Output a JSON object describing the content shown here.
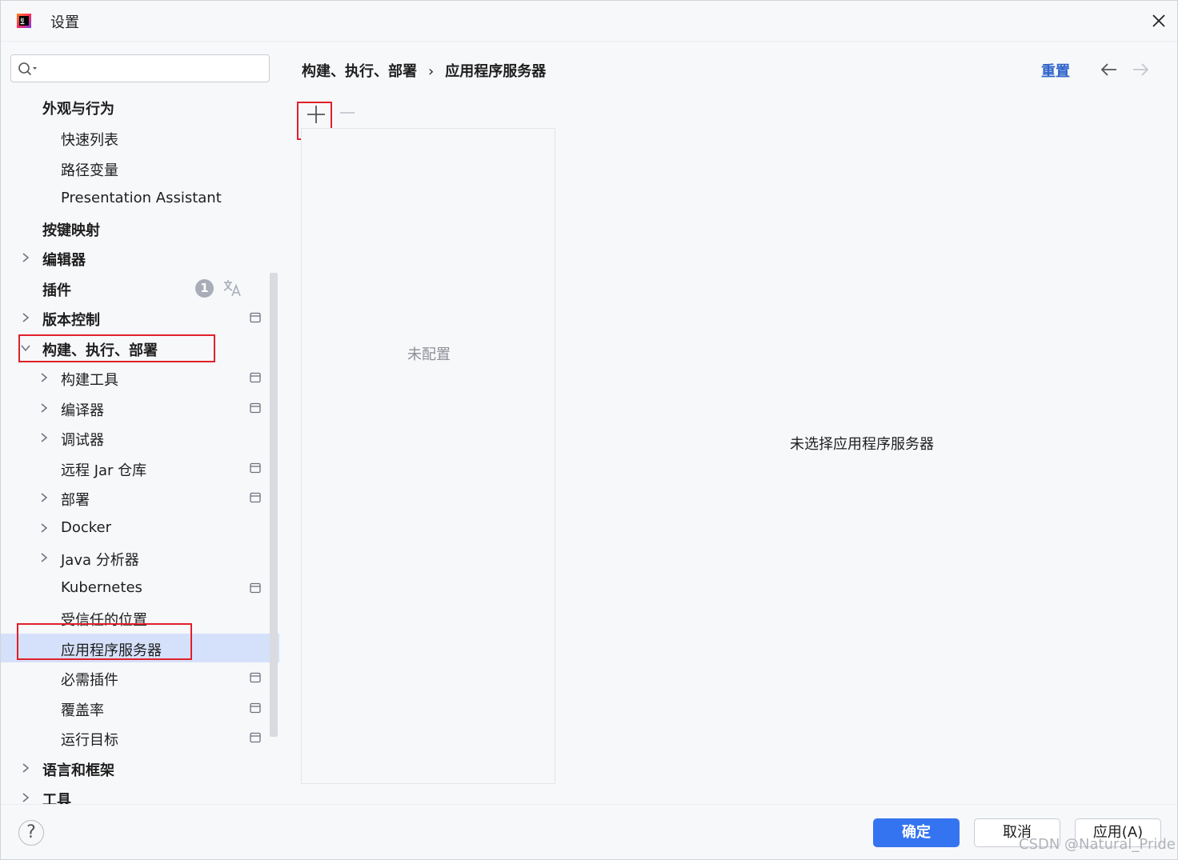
{
  "window": {
    "title": "设置"
  },
  "search": {
    "placeholder": "",
    "value": ""
  },
  "sidebar": {
    "items": [
      {
        "label": "外观与行为",
        "level": 0,
        "bold": true,
        "chevron": "",
        "icon": ""
      },
      {
        "label": "快速列表",
        "level": 1,
        "bold": false,
        "chevron": "",
        "icon": ""
      },
      {
        "label": "路径变量",
        "level": 1,
        "bold": false,
        "chevron": "",
        "icon": ""
      },
      {
        "label": "Presentation Assistant",
        "level": 1,
        "bold": false,
        "chevron": "",
        "icon": ""
      },
      {
        "label": "按键映射",
        "level": 0,
        "bold": true,
        "chevron": "",
        "icon": ""
      },
      {
        "label": "编辑器",
        "level": 0,
        "bold": true,
        "chevron": "right",
        "icon": ""
      },
      {
        "label": "插件",
        "level": 0,
        "bold": true,
        "chevron": "",
        "icon": "",
        "badge": "1"
      },
      {
        "label": "版本控制",
        "level": 0,
        "bold": true,
        "chevron": "right",
        "icon": "project-scope-icon"
      },
      {
        "label": "构建、执行、部署",
        "level": 0,
        "bold": true,
        "chevron": "down",
        "icon": ""
      },
      {
        "label": "构建工具",
        "level": 1,
        "bold": false,
        "chevron": "right",
        "icon": "project-scope-icon"
      },
      {
        "label": "编译器",
        "level": 1,
        "bold": false,
        "chevron": "right",
        "icon": "project-scope-icon"
      },
      {
        "label": "调试器",
        "level": 1,
        "bold": false,
        "chevron": "right",
        "icon": ""
      },
      {
        "label": "远程 Jar 仓库",
        "level": 1,
        "bold": false,
        "chevron": "",
        "icon": "project-scope-icon"
      },
      {
        "label": "部署",
        "level": 1,
        "bold": false,
        "chevron": "right",
        "icon": "project-scope-icon"
      },
      {
        "label": "Docker",
        "level": 1,
        "bold": false,
        "chevron": "right",
        "icon": ""
      },
      {
        "label": "Java 分析器",
        "level": 1,
        "bold": false,
        "chevron": "right",
        "icon": ""
      },
      {
        "label": "Kubernetes",
        "level": 1,
        "bold": false,
        "chevron": "",
        "icon": "project-scope-icon"
      },
      {
        "label": "受信任的位置",
        "level": 1,
        "bold": false,
        "chevron": "",
        "icon": ""
      },
      {
        "label": "应用程序服务器",
        "level": 1,
        "bold": false,
        "chevron": "",
        "icon": "",
        "selected": true
      },
      {
        "label": "必需插件",
        "level": 1,
        "bold": false,
        "chevron": "",
        "icon": "project-scope-icon"
      },
      {
        "label": "覆盖率",
        "level": 1,
        "bold": false,
        "chevron": "",
        "icon": "project-scope-icon"
      },
      {
        "label": "运行目标",
        "level": 1,
        "bold": false,
        "chevron": "",
        "icon": "project-scope-icon"
      },
      {
        "label": "语言和框架",
        "level": 0,
        "bold": true,
        "chevron": "right",
        "icon": ""
      },
      {
        "label": "工具",
        "level": 0,
        "bold": true,
        "chevron": "right",
        "icon": ""
      }
    ]
  },
  "breadcrumb": {
    "parent": "构建、执行、部署",
    "separator": "›",
    "current": "应用程序服务器"
  },
  "header": {
    "reset_label": "重置"
  },
  "toolbar": {
    "add_label": "+",
    "remove_label": "—"
  },
  "server_list": {
    "empty_text": "未配置"
  },
  "detail": {
    "empty_text": "未选择应用程序服务器"
  },
  "footer": {
    "help_label": "?",
    "ok_label": "确定",
    "cancel_label": "取消",
    "apply_label": "应用(A)"
  },
  "watermark": "CSDN @Natural_Pride",
  "colors": {
    "accent": "#3574f0",
    "selection": "#d5e1fb",
    "highlight_box": "#e0202a",
    "link": "#2f63c9"
  }
}
